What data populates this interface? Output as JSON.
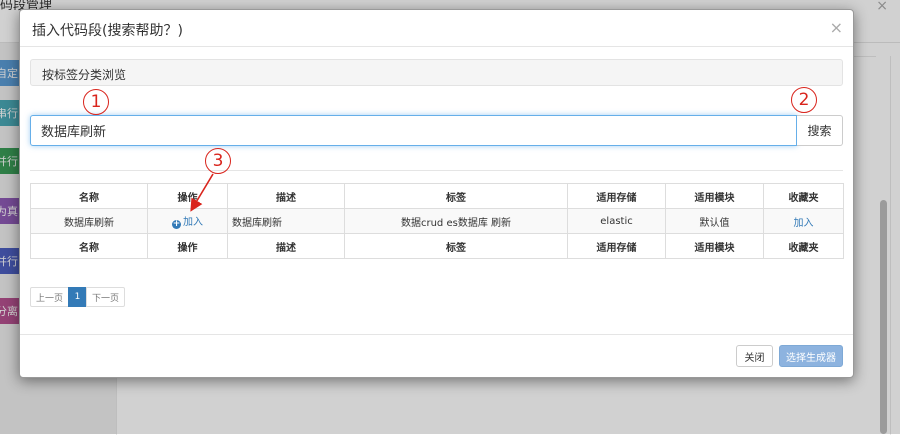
{
  "background": {
    "page_title": "码段管理",
    "close_glyph": "×",
    "blocks": [
      {
        "label": "自定",
        "color": "#5b9bd5"
      },
      {
        "label": "串行",
        "color": "#4aa8b5"
      },
      {
        "label": "并行",
        "color": "#3a9c57"
      },
      {
        "label": "为真",
        "color": "#8e5bb5"
      },
      {
        "label": "并行",
        "color": "#4c5fc0"
      },
      {
        "label": "分离",
        "color": "#b5518f"
      }
    ]
  },
  "modal": {
    "title": "插入代码段(搜索帮助？)",
    "close_glyph": "×",
    "browse_label": "按标签分类浏览",
    "search": {
      "value": "数据库刷新",
      "button_label": "搜索"
    },
    "table": {
      "headers": [
        "名称",
        "操作",
        "描述",
        "标签",
        "适用存储",
        "适用模块",
        "收藏夹"
      ],
      "rows": [
        {
          "name": "数据库刷新",
          "action": "加入",
          "desc": "数据库刷新",
          "tags": "数据crud es数据库 刷新",
          "storage": "elastic",
          "module": "默认值",
          "favorite": "加入"
        }
      ],
      "footer": [
        "名称",
        "操作",
        "描述",
        "标签",
        "适用存储",
        "适用模块",
        "收藏夹"
      ]
    },
    "pagination": {
      "prev": "上一页",
      "current": "1",
      "next": "下一页"
    },
    "footer": {
      "close_label": "关闭",
      "generate_label": "选择生成器"
    }
  },
  "annotations": [
    "1",
    "2",
    "3"
  ],
  "colors": {
    "accent": "#337ab7",
    "annotation": "#d9241c"
  }
}
